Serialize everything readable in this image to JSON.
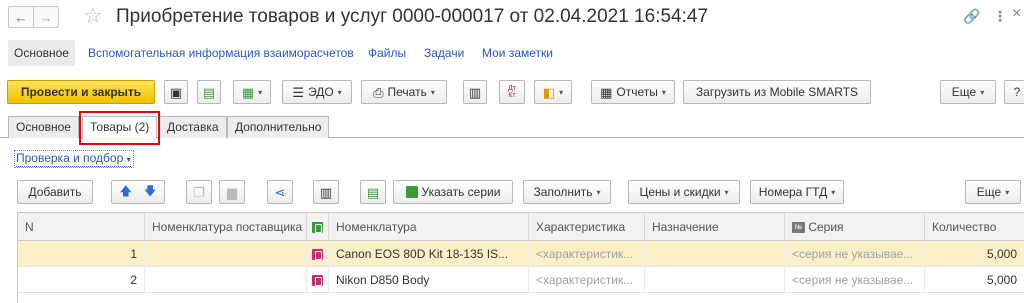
{
  "titlebar": {
    "back_glyph": "←",
    "forward_glyph": "→",
    "title": "Приобретение товаров и услуг 0000-000017 от 02.04.2021 16:54:47",
    "link_glyph": "🔗",
    "more_glyph": "⋮",
    "close_glyph": "×"
  },
  "sections": {
    "active": "Основное",
    "links": [
      "Вспомогательная информация взаиморасчетов",
      "Файлы",
      "Задачи",
      "Мои заметки"
    ]
  },
  "commands": {
    "post_close": "Провести и закрыть",
    "edo": "ЭДО",
    "print": "Печать",
    "reports": "Отчеты",
    "load_mobile": "Загрузить из Mobile SMARTS",
    "more": "Еще",
    "help": "?"
  },
  "tabs": [
    "Основное",
    "Товары (2)",
    "Доставка",
    "Дополнительно"
  ],
  "selected_tab_index": 1,
  "check_link": "Проверка и подбор",
  "table_toolbar": {
    "add": "Добавить",
    "specify_series": "Указать серии",
    "fill": "Заполнить",
    "prices_discounts": "Цены и скидки",
    "gtd_numbers": "Номера ГТД",
    "more": "Еще"
  },
  "grid": {
    "headers": {
      "n": "N",
      "supplier_item": "Номенклатура поставщика",
      "item": "Номенклатура",
      "characteristic": "Характеристика",
      "purpose": "Назначение",
      "series": "Серия",
      "qty": "Количество"
    },
    "rows": [
      {
        "n": "1",
        "supplier_item": "",
        "item": "Canon EOS 80D Kit 18-135 IS...",
        "characteristic": "<характеристик...",
        "purpose": "",
        "series": "<серия не указывае...",
        "qty": "5,000"
      },
      {
        "n": "2",
        "supplier_item": "",
        "item": "Nikon D850 Body",
        "characteristic": "<характеристик...",
        "purpose": "",
        "series": "<серия не указывае...",
        "qty": "5,000"
      }
    ]
  },
  "colors": {
    "primary_button": "#f2c100",
    "highlight_frame": "#e8000d",
    "link": "#2b58b8",
    "selected_row": "#faf0c8"
  }
}
